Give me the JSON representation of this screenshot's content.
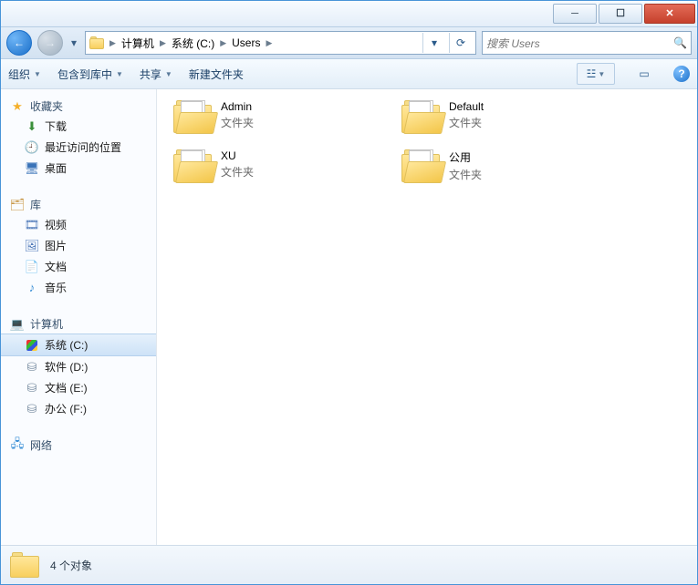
{
  "titlebar": {
    "min_glyph": "─",
    "max_glyph": "☐",
    "close_glyph": "✕"
  },
  "nav": {
    "back_glyph": "←",
    "fwd_glyph": "→",
    "dd_glyph": "▾",
    "refresh_glyph": "⟳"
  },
  "breadcrumbs": [
    {
      "label": "计算机"
    },
    {
      "label": "系统 (C:)"
    },
    {
      "label": "Users"
    }
  ],
  "breadcrumb_sep": "▶",
  "search": {
    "placeholder": "搜索 Users",
    "icon_glyph": "🔍"
  },
  "toolbar": {
    "organize": "组织",
    "include": "包含到库中",
    "share": "共享",
    "newfolder": "新建文件夹",
    "caret": "▼",
    "view_glyph": "☳",
    "preview_glyph": "▭",
    "help_glyph": "?"
  },
  "navpane": {
    "favorites": "收藏夹",
    "downloads": "下载",
    "recent": "最近访问的位置",
    "desktop": "桌面",
    "libraries": "库",
    "videos": "视频",
    "pictures": "图片",
    "documents": "文档",
    "music": "音乐",
    "computer": "计算机",
    "drive_c": "系统 (C:)",
    "drive_d": "软件 (D:)",
    "drive_e": "文档 (E:)",
    "drive_f": "办公 (F:)",
    "network": "网络"
  },
  "folder_type_label": "文件夹",
  "items": [
    {
      "name": "Admin"
    },
    {
      "name": "Default"
    },
    {
      "name": "XU"
    },
    {
      "name": "公用"
    }
  ],
  "status": {
    "count_label": "4 个对象"
  }
}
